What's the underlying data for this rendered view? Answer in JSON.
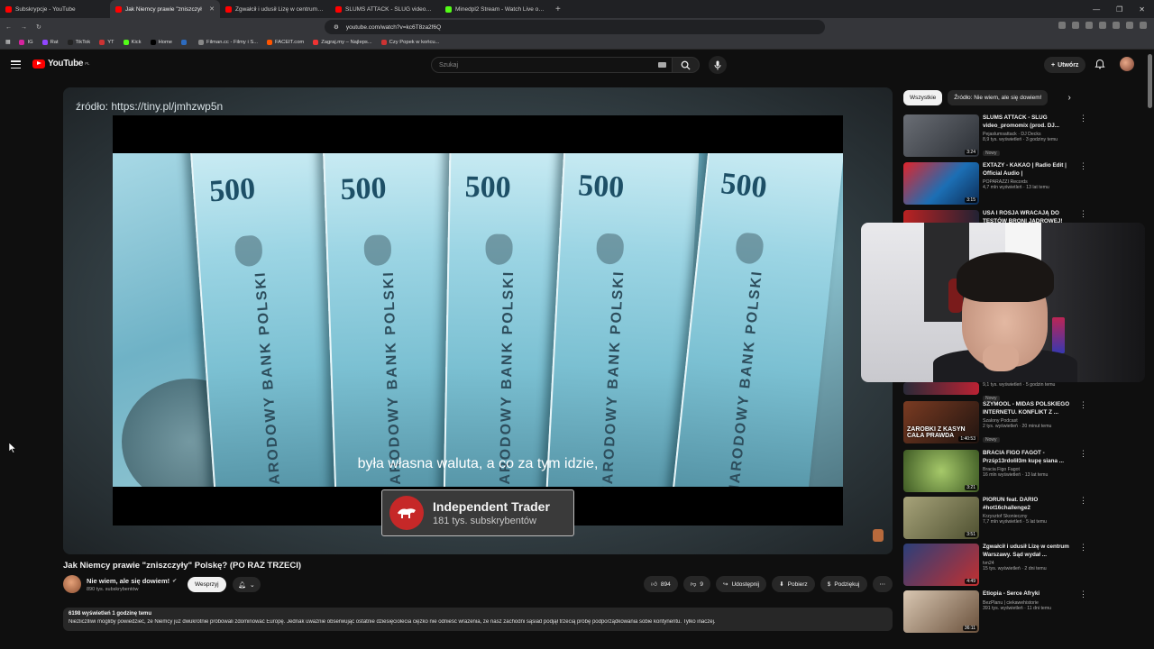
{
  "browser": {
    "tabs": [
      {
        "title": "Subskrypcje - YouTube",
        "color": "#ff0000",
        "active": false
      },
      {
        "title": "Jak Niemcy prawie \"zniszczył",
        "color": "#ff0000",
        "active": true
      },
      {
        "title": "Zgwałcił i udusił Lizę w centrum Wa",
        "color": "#ff0000",
        "active": false
      },
      {
        "title": "SLUMS ATTACK - SLUG video_promo",
        "color": "#ff0000",
        "active": false
      },
      {
        "title": "Minedpl2 Stream - Watch Live on Ki",
        "color": "#53fc18",
        "active": false
      }
    ],
    "new_tab": "+",
    "window_controls": [
      "—",
      "❐",
      "✕"
    ],
    "url": "youtube.com/watch?v=kc6T8za2f6Q",
    "bookmarks": [
      "IG",
      "Rat",
      "TikTok",
      "YT",
      "Kick",
      "Home",
      "",
      "Filman.cc - Filmy i S...",
      "FACEIT.com",
      "Zagraj.my – Najleps...",
      "Czy Popek w końcu..."
    ]
  },
  "youtube": {
    "logo_text": "YouTube",
    "logo_region": "PL",
    "search_placeholder": "Szukaj",
    "create_label": "Utwórz"
  },
  "video": {
    "source_overlay": "źródło: https://tiny.pl/jmhzwp5n",
    "banknote_value": "500",
    "banknote_text": "NARODOWY BANK POLSKI",
    "subtitle": "była własna waluta, a co za tym idzie,",
    "brand_name": "Independent Trader",
    "brand_subs": "181 tys. subskrybentów",
    "title": "Jak Niemcy prawie \"zniszczyły\" Polskę? (PO RAZ TRZECI)",
    "channel_name": "Nie wiem, ale się dowiem!",
    "channel_subs": "890 tys. subskrybentów",
    "support_label": "Wesprzyj",
    "likes": "894",
    "dislikes": "9",
    "share_label": "Udostępnij",
    "download_label": "Pobierz",
    "thanks_label": "Podziękuj",
    "views_time": "6198 wyświetleń  1 godzinę temu",
    "description": "Niezliczlliwi mogliby powiedzieć, że Niemcy już dwukrotnie próbowali zdominować Europę. Jednak uważnie obserwując ostatnie dziesięciolecia ciężko nie odnieść wrażenia, że nasz zachodni sąsiad podjął trzecią próbę podporządkowania sobie kontynentu. Tylko inaczej."
  },
  "chips": [
    "Wszystkie",
    "Źródło: Nie wiem, ale się dowiem!"
  ],
  "recommendations": [
    {
      "title": "SLUMS ATTACK - SLUG video_promomix (prod. DJ...",
      "channel": "Pejaslumsattack · DJ Decks",
      "stats": "8,9 tys. wyświetleń · 3 godziny temu",
      "badge": "Nowy",
      "duration": "3:24",
      "thumb": "#3b3f45"
    },
    {
      "title": "EXTAZY - KAKAO | Radio Edit | Official Audio |",
      "channel": "POPARAZZI Records",
      "stats": "4,7 mln wyświetleń · 13 lat temu",
      "badge": "",
      "duration": "3:15",
      "thumb": "#1c6fb5"
    },
    {
      "title": "USA I ROSJA WRACAJĄ DO TESTÓW BRONI JĄDROWEJ!",
      "channel": "",
      "stats": "",
      "badge": "",
      "duration": "",
      "thumb": "#a33"
    },
    {
      "title": "",
      "channel": "",
      "stats": "9,1 tys. wyświetleń · 5 godzin temu",
      "badge": "Nowy",
      "duration": "",
      "thumb": "#2a2a38"
    },
    {
      "title": "SZYMOOL - MIDAS POLSKIEGO INTERNETU. KONFLIKT Z ...",
      "channel": "Szalony Podcast",
      "stats": "2 tys. wyświetleń · 20 minut temu",
      "badge": "Nowy",
      "duration": "1:40:53",
      "thumb": "#5a3122"
    },
    {
      "title": "BRACIA FIGO FAGOT - Przśp13rdolił3m kupę siana ...",
      "channel": "Bracia Figo Fagot",
      "stats": "16 mln wyświetleń · 13 lat temu",
      "badge": "",
      "duration": "3:21",
      "thumb": "#6f9a3a"
    },
    {
      "title": "PIORUN feat. DARIO #hot16challenge2",
      "channel": "Krzysztof Skonieczny",
      "stats": "7,7 mln wyświetleń · 5 lat temu",
      "badge": "",
      "duration": "3:51",
      "thumb": "#8d8a55"
    },
    {
      "title": "Zgwałcił i udusił Lizę w centrum Warszawy. Sąd wydał ...",
      "channel": "tvn24",
      "stats": "15 tys. wyświetleń · 2 dni temu",
      "badge": "",
      "duration": "4:49",
      "thumb": "#2b3f7a"
    },
    {
      "title": "Etiopia - Serce Afryki",
      "channel": "BezPlanu | ciekawehistorie",
      "stats": "391 tys. wyświetleń · 11 dni temu",
      "badge": "",
      "duration": "36:11",
      "thumb": "#8c7a66"
    }
  ]
}
